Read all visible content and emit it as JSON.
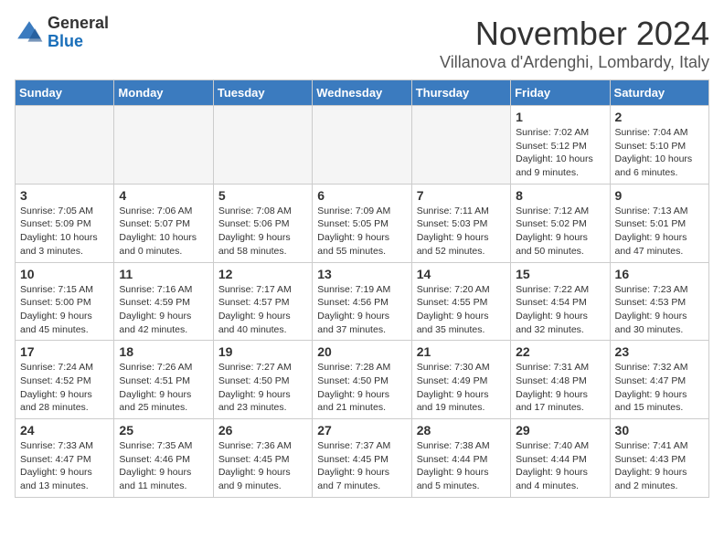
{
  "logo": {
    "general": "General",
    "blue": "Blue"
  },
  "title": "November 2024",
  "location": "Villanova d'Ardenghi, Lombardy, Italy",
  "weekdays": [
    "Sunday",
    "Monday",
    "Tuesday",
    "Wednesday",
    "Thursday",
    "Friday",
    "Saturday"
  ],
  "weeks": [
    [
      {
        "day": "",
        "info": ""
      },
      {
        "day": "",
        "info": ""
      },
      {
        "day": "",
        "info": ""
      },
      {
        "day": "",
        "info": ""
      },
      {
        "day": "",
        "info": ""
      },
      {
        "day": "1",
        "info": "Sunrise: 7:02 AM\nSunset: 5:12 PM\nDaylight: 10 hours and 9 minutes."
      },
      {
        "day": "2",
        "info": "Sunrise: 7:04 AM\nSunset: 5:10 PM\nDaylight: 10 hours and 6 minutes."
      }
    ],
    [
      {
        "day": "3",
        "info": "Sunrise: 7:05 AM\nSunset: 5:09 PM\nDaylight: 10 hours and 3 minutes."
      },
      {
        "day": "4",
        "info": "Sunrise: 7:06 AM\nSunset: 5:07 PM\nDaylight: 10 hours and 0 minutes."
      },
      {
        "day": "5",
        "info": "Sunrise: 7:08 AM\nSunset: 5:06 PM\nDaylight: 9 hours and 58 minutes."
      },
      {
        "day": "6",
        "info": "Sunrise: 7:09 AM\nSunset: 5:05 PM\nDaylight: 9 hours and 55 minutes."
      },
      {
        "day": "7",
        "info": "Sunrise: 7:11 AM\nSunset: 5:03 PM\nDaylight: 9 hours and 52 minutes."
      },
      {
        "day": "8",
        "info": "Sunrise: 7:12 AM\nSunset: 5:02 PM\nDaylight: 9 hours and 50 minutes."
      },
      {
        "day": "9",
        "info": "Sunrise: 7:13 AM\nSunset: 5:01 PM\nDaylight: 9 hours and 47 minutes."
      }
    ],
    [
      {
        "day": "10",
        "info": "Sunrise: 7:15 AM\nSunset: 5:00 PM\nDaylight: 9 hours and 45 minutes."
      },
      {
        "day": "11",
        "info": "Sunrise: 7:16 AM\nSunset: 4:59 PM\nDaylight: 9 hours and 42 minutes."
      },
      {
        "day": "12",
        "info": "Sunrise: 7:17 AM\nSunset: 4:57 PM\nDaylight: 9 hours and 40 minutes."
      },
      {
        "day": "13",
        "info": "Sunrise: 7:19 AM\nSunset: 4:56 PM\nDaylight: 9 hours and 37 minutes."
      },
      {
        "day": "14",
        "info": "Sunrise: 7:20 AM\nSunset: 4:55 PM\nDaylight: 9 hours and 35 minutes."
      },
      {
        "day": "15",
        "info": "Sunrise: 7:22 AM\nSunset: 4:54 PM\nDaylight: 9 hours and 32 minutes."
      },
      {
        "day": "16",
        "info": "Sunrise: 7:23 AM\nSunset: 4:53 PM\nDaylight: 9 hours and 30 minutes."
      }
    ],
    [
      {
        "day": "17",
        "info": "Sunrise: 7:24 AM\nSunset: 4:52 PM\nDaylight: 9 hours and 28 minutes."
      },
      {
        "day": "18",
        "info": "Sunrise: 7:26 AM\nSunset: 4:51 PM\nDaylight: 9 hours and 25 minutes."
      },
      {
        "day": "19",
        "info": "Sunrise: 7:27 AM\nSunset: 4:50 PM\nDaylight: 9 hours and 23 minutes."
      },
      {
        "day": "20",
        "info": "Sunrise: 7:28 AM\nSunset: 4:50 PM\nDaylight: 9 hours and 21 minutes."
      },
      {
        "day": "21",
        "info": "Sunrise: 7:30 AM\nSunset: 4:49 PM\nDaylight: 9 hours and 19 minutes."
      },
      {
        "day": "22",
        "info": "Sunrise: 7:31 AM\nSunset: 4:48 PM\nDaylight: 9 hours and 17 minutes."
      },
      {
        "day": "23",
        "info": "Sunrise: 7:32 AM\nSunset: 4:47 PM\nDaylight: 9 hours and 15 minutes."
      }
    ],
    [
      {
        "day": "24",
        "info": "Sunrise: 7:33 AM\nSunset: 4:47 PM\nDaylight: 9 hours and 13 minutes."
      },
      {
        "day": "25",
        "info": "Sunrise: 7:35 AM\nSunset: 4:46 PM\nDaylight: 9 hours and 11 minutes."
      },
      {
        "day": "26",
        "info": "Sunrise: 7:36 AM\nSunset: 4:45 PM\nDaylight: 9 hours and 9 minutes."
      },
      {
        "day": "27",
        "info": "Sunrise: 7:37 AM\nSunset: 4:45 PM\nDaylight: 9 hours and 7 minutes."
      },
      {
        "day": "28",
        "info": "Sunrise: 7:38 AM\nSunset: 4:44 PM\nDaylight: 9 hours and 5 minutes."
      },
      {
        "day": "29",
        "info": "Sunrise: 7:40 AM\nSunset: 4:44 PM\nDaylight: 9 hours and 4 minutes."
      },
      {
        "day": "30",
        "info": "Sunrise: 7:41 AM\nSunset: 4:43 PM\nDaylight: 9 hours and 2 minutes."
      }
    ]
  ]
}
